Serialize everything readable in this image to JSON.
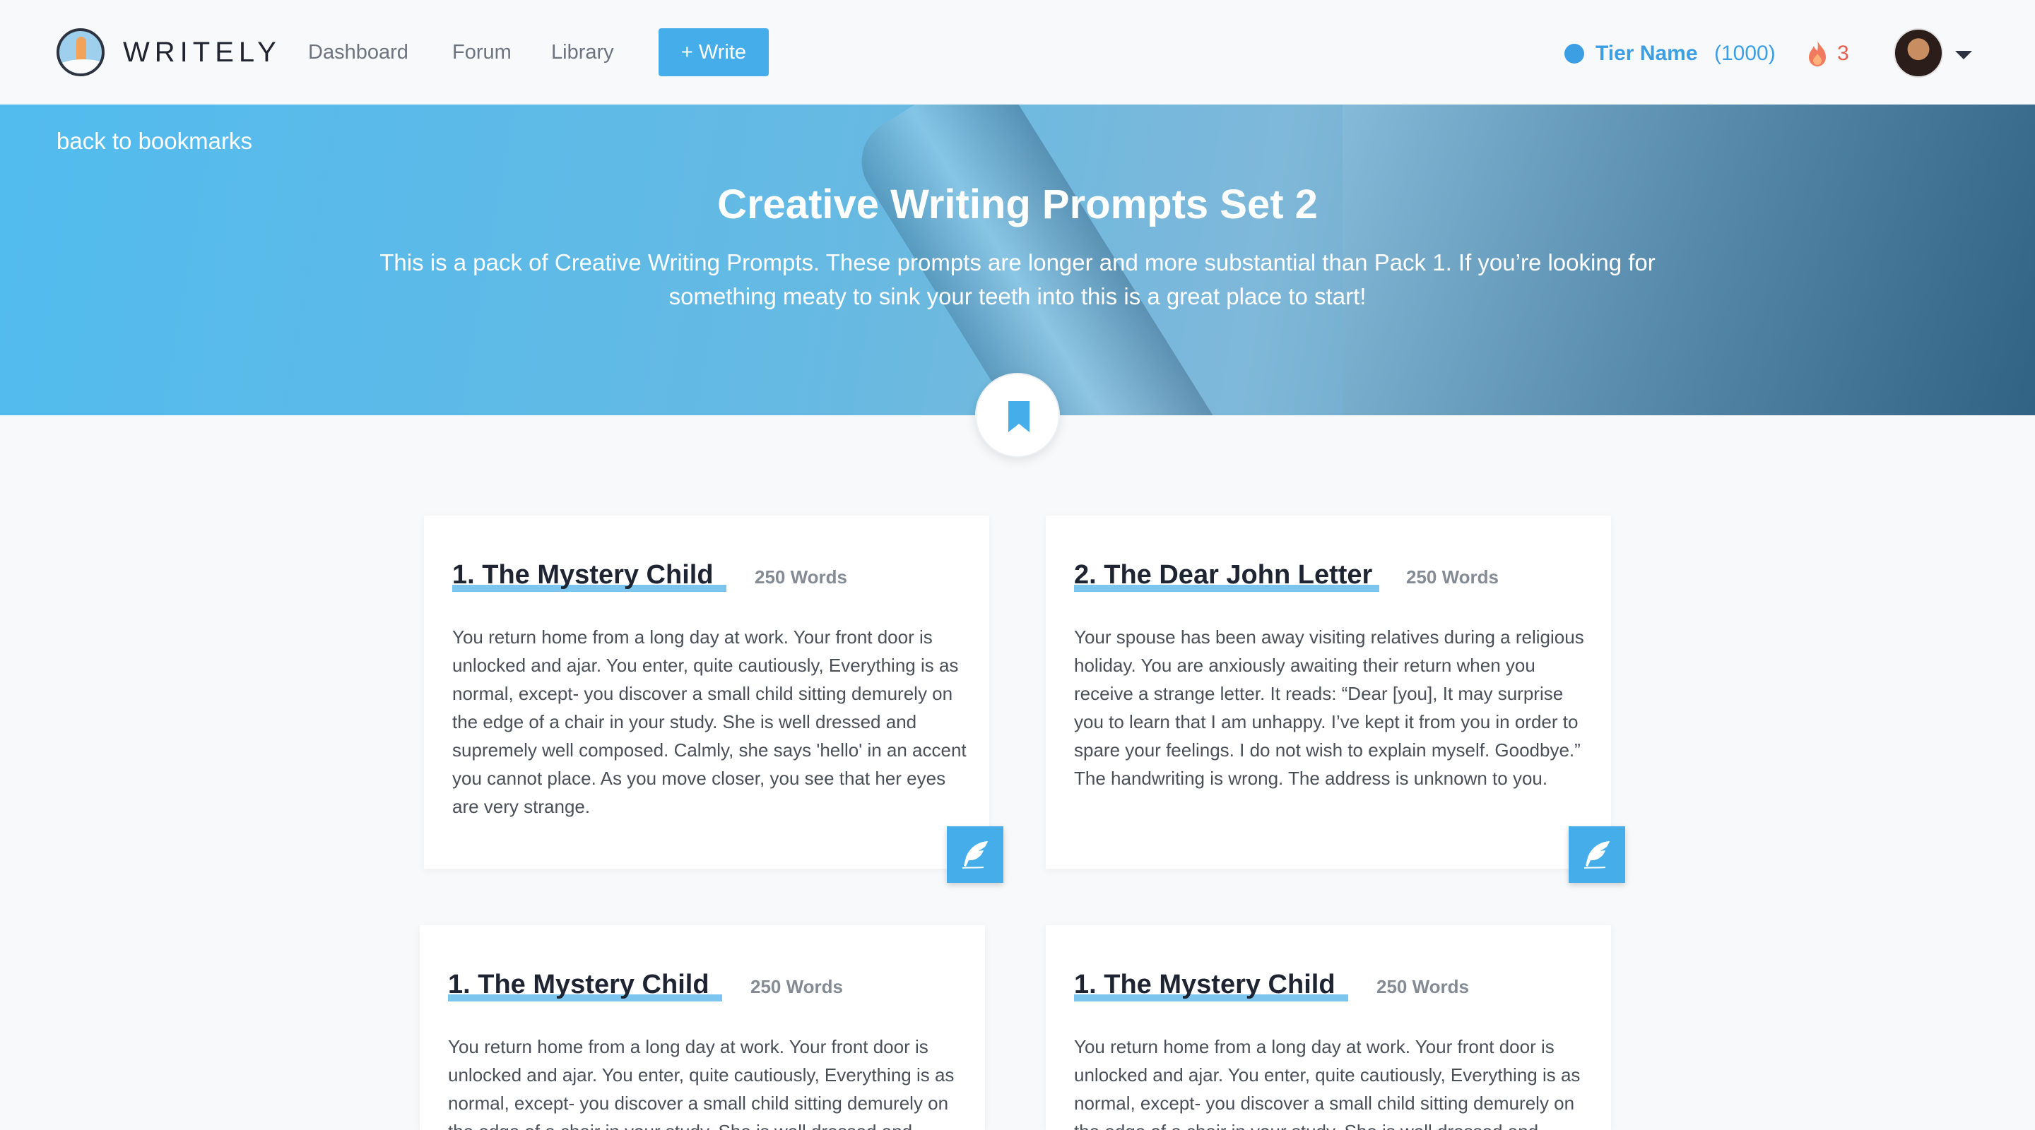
{
  "nav": {
    "logo_text": "WRITELY",
    "links": [
      "Dashboard",
      "Forum",
      "Library"
    ],
    "write_button": "+ Write",
    "tier_name": "Tier Name",
    "tier_points": "(1000)",
    "streak_count": "3"
  },
  "hero": {
    "back_link": "back to bookmarks",
    "title": "Creative Writing Prompts Set 2",
    "description": "This is a pack of Creative Writing Prompts. These prompts are longer and more substantial than Pack 1. If you’re looking for something meaty to sink your teeth into this is a great place to start!"
  },
  "prompts": [
    {
      "title": "1. The Mystery Child",
      "word_count": "250 Words",
      "body": "You return home from a long day at work. Your front door is unlocked and ajar. You enter, quite cautiously, Everything is as normal, except- you discover a small child sitting demurely on the edge of a chair in your study. She is well dressed and supremely well composed. Calmly, she says 'hello' in an accent you cannot place. As you move closer, you see that her eyes are very strange."
    },
    {
      "title": "2. The Dear John Letter",
      "word_count": "250 Words",
      "body": "Your spouse has been away visiting relatives during a religious holiday. You are anxiously awaiting their return when you receive a strange letter. It reads: “Dear [you], It may surprise you to learn that I am unhappy. I’ve kept it from you in order to spare your feelings. I do not wish to explain myself. Goodbye.” The handwriting is wrong. The address is unknown to you."
    },
    {
      "title": "1. The Mystery Child",
      "word_count": "250 Words",
      "body": "You return home from a long day at work. Your front door is unlocked and ajar. You enter, quite cautiously, Everything is as normal, except- you discover a small child sitting demurely on the edge of a chair in your study. She is well dressed and supremely well composed."
    },
    {
      "title": "1. The Mystery Child",
      "word_count": "250 Words",
      "body": "You return home from a long day at work. Your front door is unlocked and ajar. You enter, quite cautiously, Everything is as normal, except- you discover a small child sitting demurely on the edge of a chair in your study. She is well dressed and supremely well composed."
    }
  ],
  "colors": {
    "accent": "#45aeea",
    "tier": "#3d9fe3",
    "streak": "#ea5a4a"
  },
  "icons": [
    "logo-icon",
    "flame-icon",
    "avatar",
    "chevron-down-icon",
    "bookmark-icon",
    "quill-icon"
  ]
}
